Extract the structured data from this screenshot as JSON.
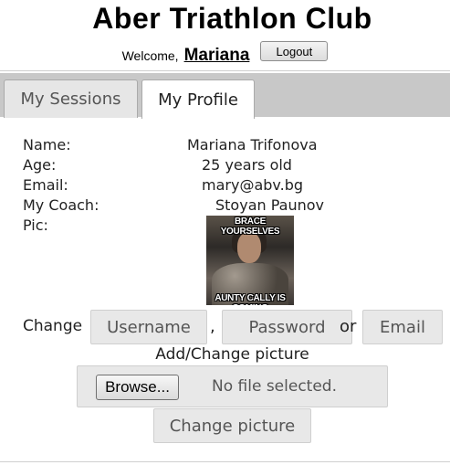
{
  "header": {
    "title": "Aber Triathlon Club",
    "welcome_text": "Welcome,",
    "username": "Mariana",
    "logout_label": "Logout"
  },
  "tabs": [
    {
      "label": "My Sessions",
      "active": false
    },
    {
      "label": "My Profile",
      "active": true
    }
  ],
  "profile": {
    "fields": [
      {
        "label": "Name:",
        "value": "Mariana Trifonova"
      },
      {
        "label": "Age:",
        "value": "25 years old"
      },
      {
        "label": "Email:",
        "value": "mary@abv.bg"
      },
      {
        "label": "My Coach:",
        "value": "Stoyan Paunov"
      },
      {
        "label": "Pic:",
        "value": ""
      }
    ],
    "pic_caption_top": "BRACE YOURSELVES",
    "pic_caption_bottom": "AUNTY CALLY IS COMING"
  },
  "change": {
    "label": "Change",
    "username_button": "Username",
    "separator_comma": ",",
    "password_button": "Password",
    "separator_or": "or",
    "email_button": "Email"
  },
  "picture_upload": {
    "label": "Add/Change picture",
    "browse_label": "Browse...",
    "file_status": "No file selected.",
    "submit_label": "Change picture"
  }
}
